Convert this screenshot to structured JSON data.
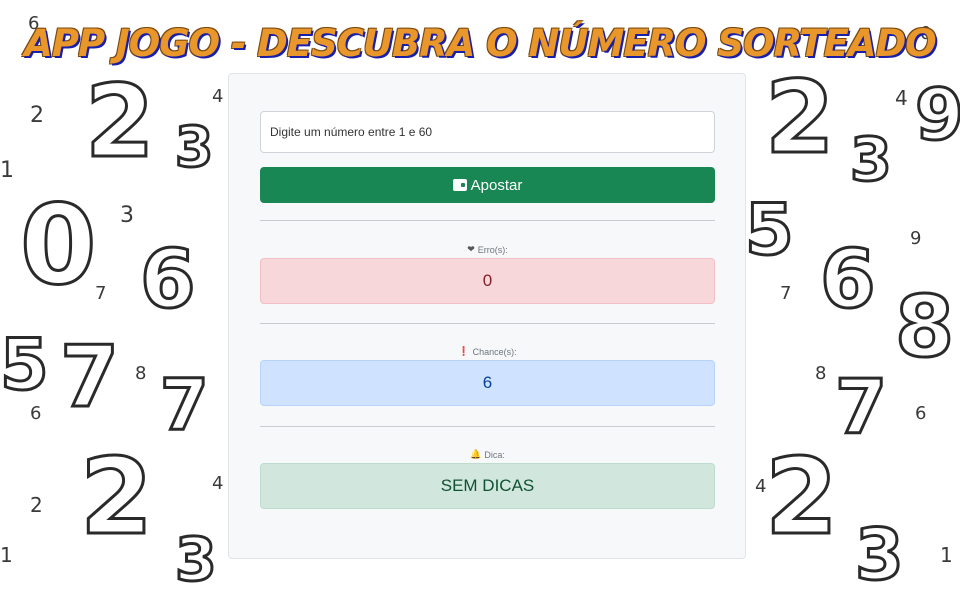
{
  "header": {
    "title": "APP JOGO - DESCUBRA O NÚMERO SORTEADO"
  },
  "form": {
    "input_placeholder": "Digite um número entre 1 e 60",
    "bet_button_label": "Apostar"
  },
  "stats": {
    "errors": {
      "label": "Erro(s):",
      "value": "0",
      "icon": "heart-pulse-icon"
    },
    "chances": {
      "label": "Chance(s):",
      "value": "6",
      "icon": "info-circle-icon"
    },
    "hint": {
      "label": "Dica:",
      "value": "SEM DICAS",
      "icon": "bell-icon"
    }
  },
  "colors": {
    "bet_button": "#198754",
    "errors_bg": "#f8d7da",
    "chances_bg": "#cfe2ff",
    "hint_bg": "#d1e7dd",
    "title": "#e9962a"
  }
}
